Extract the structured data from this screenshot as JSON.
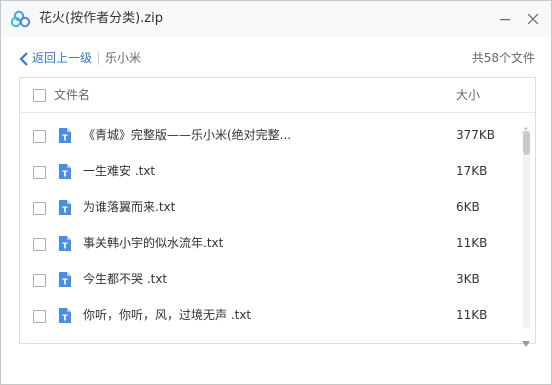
{
  "window": {
    "title": "花火(按作者分类).zip",
    "accent_color": "#3a77c9"
  },
  "nav": {
    "back_label": "返回上一级",
    "crumb": "乐小米",
    "file_count": "共58个文件"
  },
  "list": {
    "header_name": "文件名",
    "header_size": "大小",
    "rows": [
      {
        "name": "《青城》完整版——乐小米(绝对完整...",
        "size": "377KB"
      },
      {
        "name": "一生难安 .txt",
        "size": "17KB"
      },
      {
        "name": "为谁落翼而来.txt",
        "size": "6KB"
      },
      {
        "name": "事关韩小宇的似水流年.txt",
        "size": "11KB"
      },
      {
        "name": "今生都不哭 .txt",
        "size": "3KB"
      },
      {
        "name": "你听，你听，风，过境无声 .txt",
        "size": "11KB"
      }
    ]
  },
  "icons": {
    "file": "text-file-icon",
    "logo": "cloud-logo-icon"
  }
}
